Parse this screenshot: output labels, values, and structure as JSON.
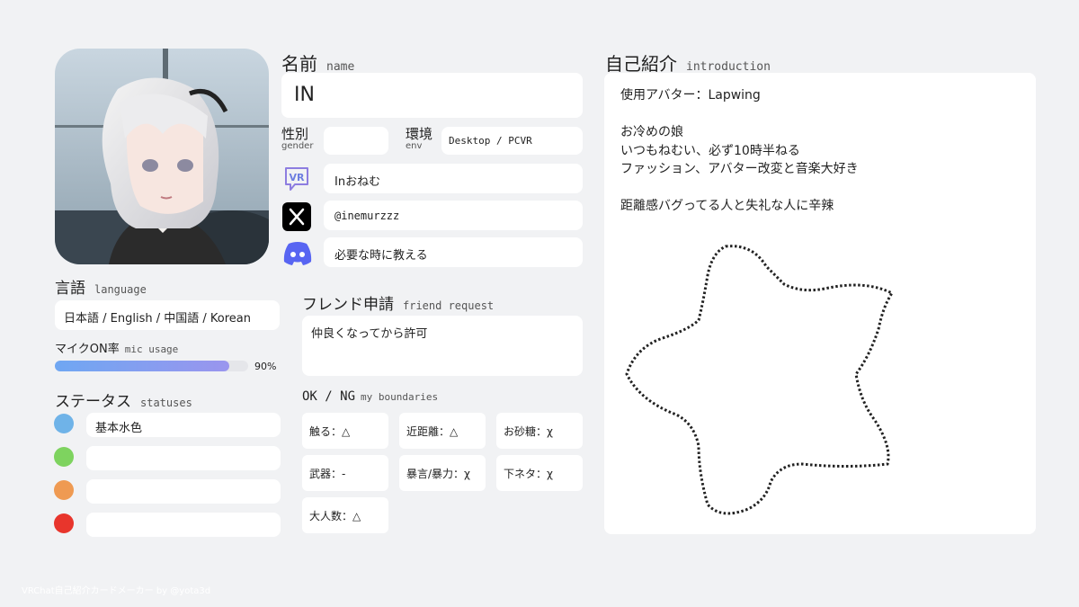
{
  "name": {
    "title": "名前",
    "subtitle": "name",
    "value": "IN"
  },
  "gender": {
    "title": "性別",
    "subtitle": "gender",
    "value": ""
  },
  "env": {
    "title": "環境",
    "subtitle": "env",
    "value": "Desktop / PCVR"
  },
  "social": {
    "vrchat": "Inおねむ",
    "x": "@inemurzzz",
    "discord": "必要な時に教える"
  },
  "language": {
    "title": "言語",
    "subtitle": "language",
    "value": "日本語 / English / 中国語 / Korean"
  },
  "mic": {
    "title": "マイクON率",
    "subtitle": "mic usage",
    "percent": 90,
    "percent_label": "90%",
    "bar_color": "#9a95ee"
  },
  "status": {
    "title": "ステータス",
    "subtitle": "statuses",
    "items": [
      {
        "color": "#6fb3e8",
        "label": "基本水色"
      },
      {
        "color": "#7ed35f",
        "label": ""
      },
      {
        "color": "#ef9a52",
        "label": ""
      },
      {
        "color": "#e8352c",
        "label": ""
      }
    ]
  },
  "friend": {
    "title": "フレンド申請",
    "subtitle": "friend request",
    "value": "仲良くなってから許可"
  },
  "boundaries": {
    "title": "OK / NG",
    "subtitle": "my boundaries",
    "items": [
      "触る：△",
      "近距離：△",
      "お砂糖：χ",
      "武器：-",
      "暴言/暴力：χ",
      "下ネタ：χ",
      "大人数：△"
    ]
  },
  "intro": {
    "title": "自己紹介",
    "subtitle": "introduction",
    "lines": [
      "使用アバター：Lapwing",
      "",
      "お冷めの娘",
      "いつもねむい、必ず10時半ねる",
      "ファッション、アバター改変と音楽大好き",
      "",
      "距離感バグってる人と失礼な人に辛辣"
    ]
  },
  "footer": "VRChat自己紹介カードメーカー by @yota3d"
}
